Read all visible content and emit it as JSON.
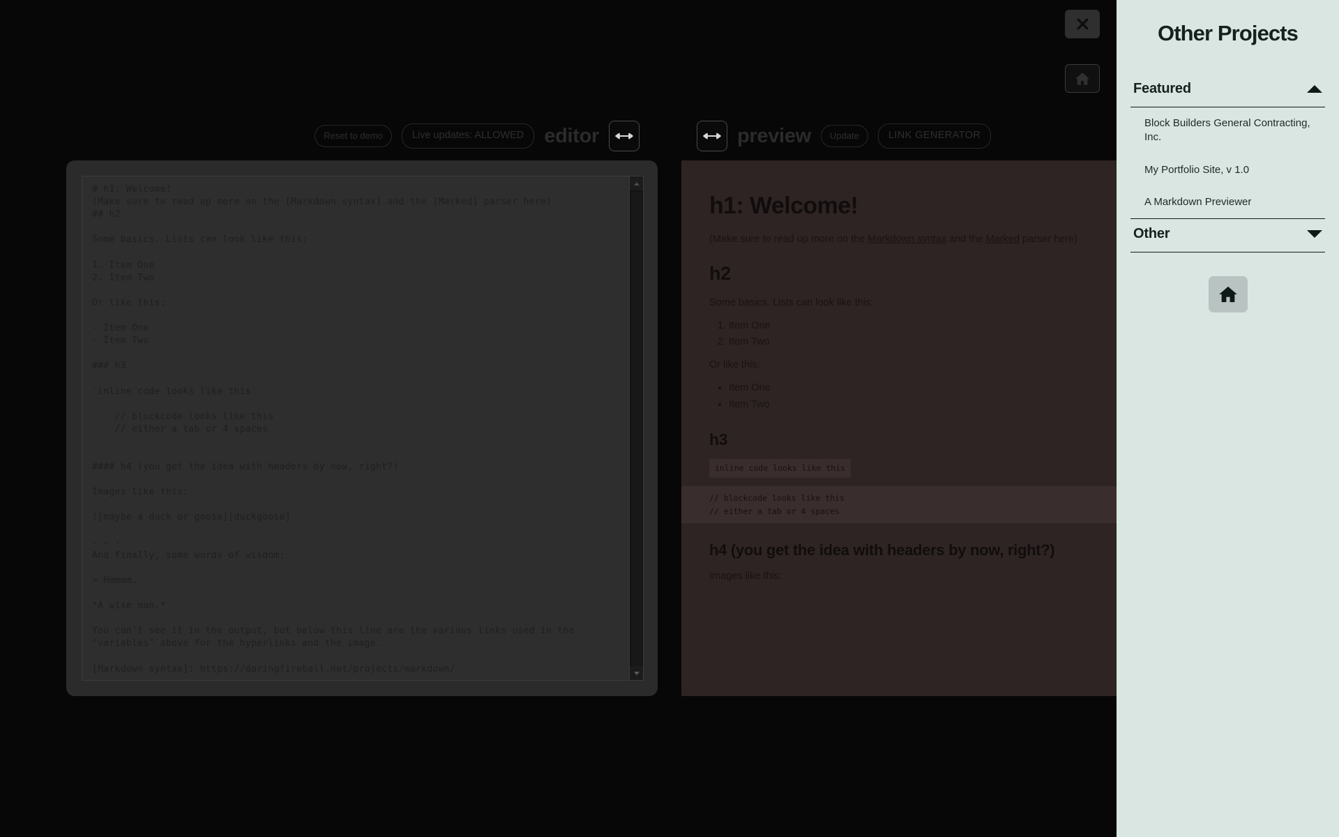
{
  "window": {
    "close_label": "×",
    "close_icon": "close-icon",
    "home_icon": "home-icon"
  },
  "editor": {
    "reset_label": "Reset to demo",
    "live_updates_label": "Live updates: ALLOWED",
    "title": "editor",
    "resize_icon": "arrows-left-right-icon",
    "content": "# h1: Welcome!\n(Make sure to read up more on the [Markdown syntax] and the [Marked] parser here)\n## h2\n\nSome basics. Lists can look like this:\n\n1. Item One\n2. Item Two\n\nOr like this:\n\n- Item One\n- Item Two\n\n### h3\n\n`inline code looks like this`\n\n    // blockcode looks like this\n    // either a tab or 4 spaces\n\n\n#### h4 (you get the idea with headers by now, right?)\n\nImages like this:\n\n![maybe a duck or goose][duckgoose]\n\n- - -\nAnd finally, some words of wisdom:\n\n> Hmmmm.\n\n*A wise man.*\n\nYou can't see it in the output, but below this line are the various links used in the\n\"variables\" above for the hyperlinks and the image.\n\n[Markdown syntax]: https://daringfireball.net/projects/markdown/"
  },
  "preview": {
    "title": "preview",
    "update_label": "Update",
    "link_generator_label": "LINK GENERATOR",
    "resize_icon": "arrows-left-right-icon",
    "h1": "h1: Welcome!",
    "intro_before": "(Make sure to read up more on the ",
    "intro_link1": "Markdown syntax",
    "intro_mid": " and the ",
    "intro_link2": "Marked",
    "intro_after": " parser here)",
    "h2": "h2",
    "basics": "Some basics. Lists can look like this:",
    "ordered_list": [
      "Item One",
      "Item Two"
    ],
    "or_like_this": "Or like this:",
    "unordered_list": [
      "Item One",
      "Item Two"
    ],
    "h3": "h3",
    "inline_code": "inline code looks like this",
    "block_code_line1": "// blockcode looks like this",
    "block_code_line2": "// either a tab or 4 spaces",
    "h4": "h4 (you get the idea with headers by now, right?)",
    "images_like_this": "Images like this:"
  },
  "sidebar": {
    "title": "Other Projects",
    "featured": {
      "label": "Featured",
      "expanded": true,
      "caret_icon": "caret-up-icon",
      "items": [
        "Block Builders General Contracting, Inc.",
        "My Portfolio Site, v 1.0",
        "A Markdown Previewer"
      ]
    },
    "other": {
      "label": "Other",
      "expanded": false,
      "caret_icon": "caret-down-icon"
    },
    "home_icon": "home-icon"
  },
  "colors": {
    "app_bg": "#070707",
    "editor_panel": "#2b2b2b",
    "preview_panel": "#2e2424",
    "sidebar_bg": "#d9e6e2",
    "sidebar_text": "#16211e"
  }
}
